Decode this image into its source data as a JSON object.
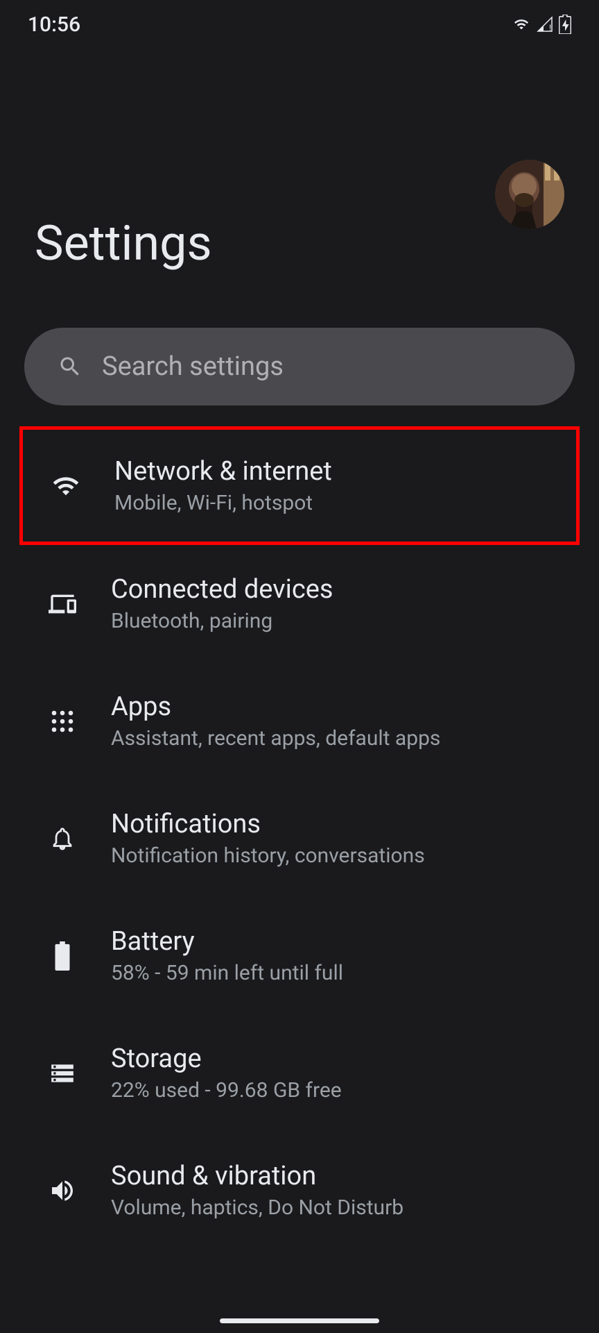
{
  "status_bar": {
    "time": "10:56"
  },
  "header": {
    "title": "Settings"
  },
  "search": {
    "placeholder": "Search settings"
  },
  "settings": [
    {
      "title": "Network & internet",
      "subtitle": "Mobile, Wi-Fi, hotspot",
      "icon": "wifi-icon",
      "highlighted": true
    },
    {
      "title": "Connected devices",
      "subtitle": "Bluetooth, pairing",
      "icon": "devices-icon",
      "highlighted": false
    },
    {
      "title": "Apps",
      "subtitle": "Assistant, recent apps, default apps",
      "icon": "apps-icon",
      "highlighted": false
    },
    {
      "title": "Notifications",
      "subtitle": "Notification history, conversations",
      "icon": "bell-icon",
      "highlighted": false
    },
    {
      "title": "Battery",
      "subtitle": "58% - 59 min left until full",
      "icon": "battery-icon",
      "highlighted": false
    },
    {
      "title": "Storage",
      "subtitle": "22% used - 99.68 GB free",
      "icon": "storage-icon",
      "highlighted": false
    },
    {
      "title": "Sound & vibration",
      "subtitle": "Volume, haptics, Do Not Disturb",
      "icon": "volume-icon",
      "highlighted": false
    }
  ]
}
